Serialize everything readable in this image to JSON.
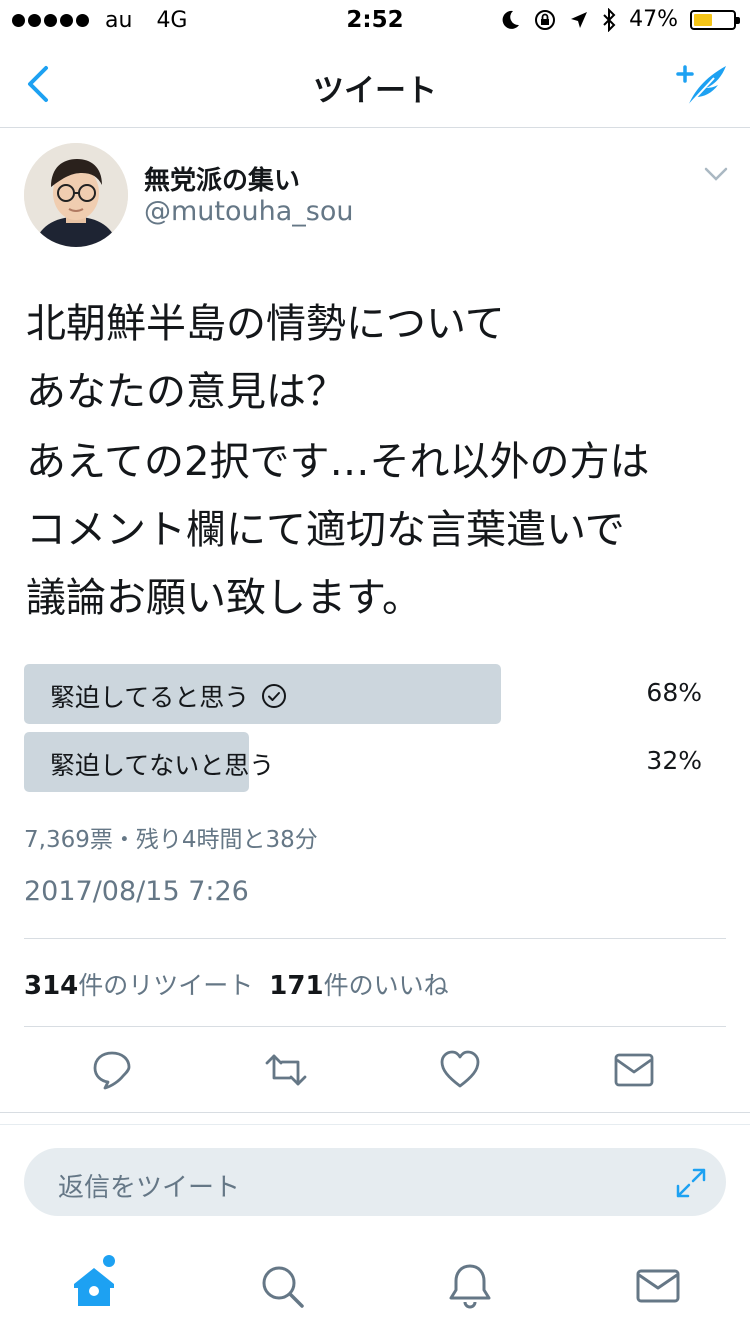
{
  "status_bar": {
    "carrier": "au",
    "network": "4G",
    "time": "2:52",
    "battery": "47%",
    "battery_level": 0.47
  },
  "nav": {
    "title": "ツイート"
  },
  "tweet": {
    "display_name": "無党派の集い",
    "handle": "@mutouha_sou",
    "text_line_1": "北朝鮮半島の情勢について\nあなたの意見は？",
    "text_line_2": "あえての2択です…それ以外の方は\nコメント欄にて適切な言葉遣いで\n議論お願い致します。",
    "timestamp": "2017/08/15 7:26"
  },
  "poll": {
    "options": [
      {
        "label": "緊迫してると思う",
        "percent_label": "68%",
        "fraction": 0.68,
        "selected": true
      },
      {
        "label": "緊迫してないと思う",
        "percent_label": "32%",
        "fraction": 0.32,
        "selected": false
      }
    ],
    "meta": "7,369票・残り4時間と38分"
  },
  "stats": {
    "retweets_count": "314",
    "retweets_label": "件のリツイート",
    "likes_count": "171",
    "likes_label": "件のいいね"
  },
  "actions": [
    "reply-icon",
    "retweet-icon",
    "like-icon",
    "dm-icon"
  ],
  "reply": {
    "placeholder": "返信をツイート"
  },
  "tabs": [
    "home-icon",
    "search-icon",
    "notifications-icon",
    "messages-icon"
  ],
  "colors": {
    "accent": "#1da1f2",
    "poll_bar": "#ccd6dd",
    "secondary_text": "#657786",
    "battery": "#f5c518"
  }
}
